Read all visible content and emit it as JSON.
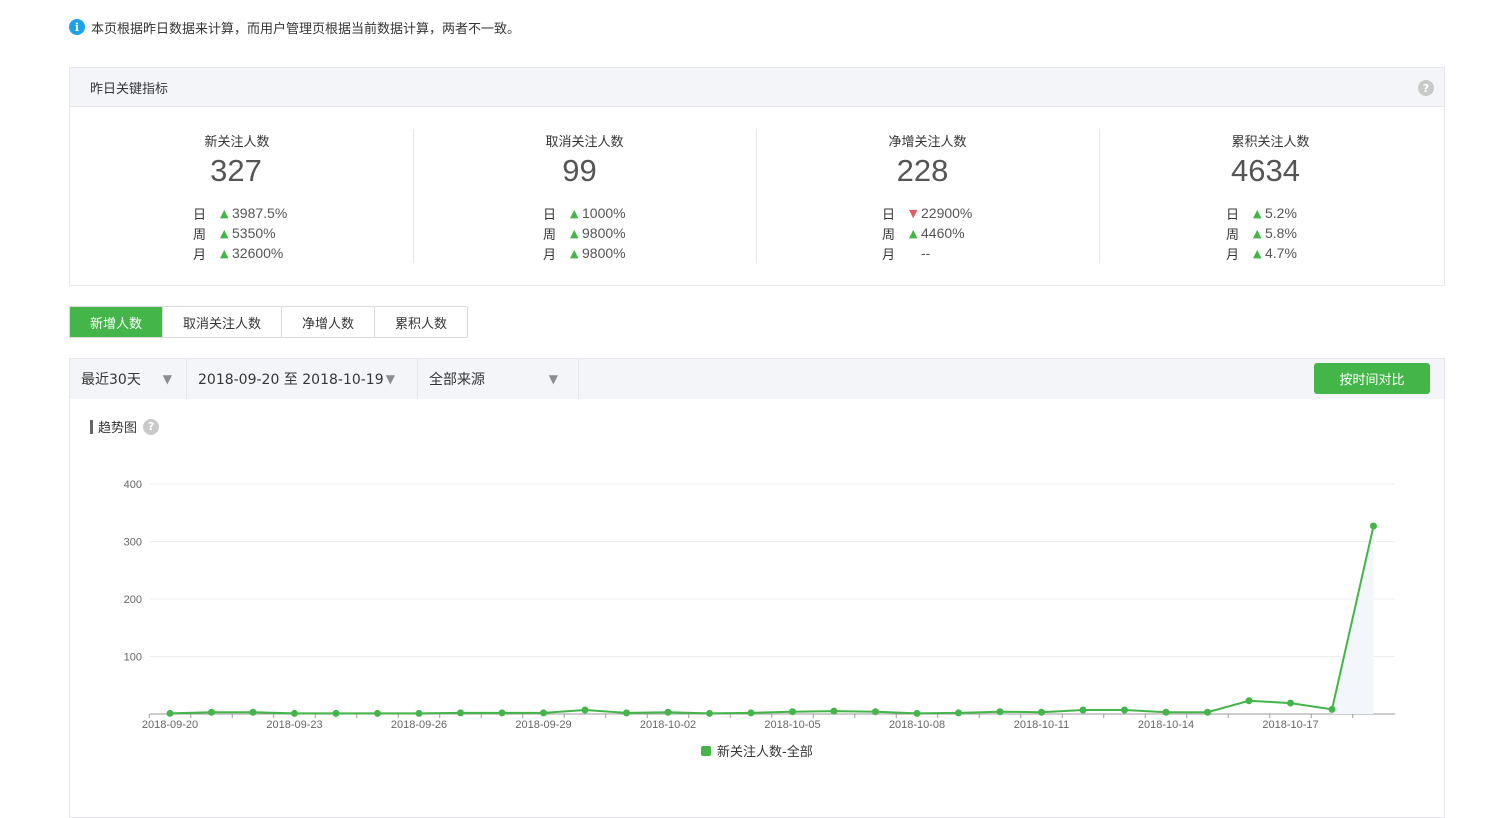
{
  "notice": {
    "icon": "info-icon",
    "text": "本页根据昨日数据来计算，而用户管理页根据当前数据计算，两者不一致。"
  },
  "kpi": {
    "title": "昨日关键指标",
    "help": "?",
    "period_labels": [
      "日",
      "周",
      "月"
    ],
    "cards": [
      {
        "title": "新关注人数",
        "value": "327",
        "rows": [
          {
            "dir": "up",
            "pct": "3987.5%"
          },
          {
            "dir": "up",
            "pct": "5350%"
          },
          {
            "dir": "up",
            "pct": "32600%"
          }
        ]
      },
      {
        "title": "取消关注人数",
        "value": "99",
        "rows": [
          {
            "dir": "up",
            "pct": "1000%"
          },
          {
            "dir": "up",
            "pct": "9800%"
          },
          {
            "dir": "up",
            "pct": "9800%"
          }
        ]
      },
      {
        "title": "净增关注人数",
        "value": "228",
        "rows": [
          {
            "dir": "down",
            "pct": "22900%"
          },
          {
            "dir": "up",
            "pct": "4460%"
          },
          {
            "dir": "none",
            "pct": "--"
          }
        ]
      },
      {
        "title": "累积关注人数",
        "value": "4634",
        "rows": [
          {
            "dir": "up",
            "pct": "5.2%"
          },
          {
            "dir": "up",
            "pct": "5.8%"
          },
          {
            "dir": "up",
            "pct": "4.7%"
          }
        ]
      }
    ]
  },
  "tabs": [
    "新增人数",
    "取消关注人数",
    "净增人数",
    "累积人数"
  ],
  "filters": {
    "range": "最近30天",
    "dates": "2018-09-20 至 2018-10-19",
    "source": "全部来源",
    "compare_button": "按时间对比"
  },
  "trend": {
    "title": "趋势图",
    "help": "?"
  },
  "colors": {
    "accent": "#44b549",
    "down": "#e15f63"
  },
  "chart_data": {
    "type": "line",
    "x": [
      "2018-09-20",
      "2018-09-21",
      "2018-09-22",
      "2018-09-23",
      "2018-09-24",
      "2018-09-25",
      "2018-09-26",
      "2018-09-27",
      "2018-09-28",
      "2018-09-29",
      "2018-09-30",
      "2018-10-01",
      "2018-10-02",
      "2018-10-03",
      "2018-10-04",
      "2018-10-05",
      "2018-10-06",
      "2018-10-07",
      "2018-10-08",
      "2018-10-09",
      "2018-10-10",
      "2018-10-11",
      "2018-10-12",
      "2018-10-13",
      "2018-10-14",
      "2018-10-15",
      "2018-10-16",
      "2018-10-17",
      "2018-10-18",
      "2018-10-19"
    ],
    "tick_labels": [
      "2018-09-20",
      "2018-09-23",
      "2018-09-26",
      "2018-09-29",
      "2018-10-02",
      "2018-10-05",
      "2018-10-08",
      "2018-10-11",
      "2018-10-14",
      "2018-10-17"
    ],
    "series": [
      {
        "name": "新关注人数-全部",
        "values": [
          1,
          3,
          3,
          1,
          1,
          1,
          1,
          2,
          2,
          2,
          7,
          2,
          3,
          1,
          2,
          4,
          5,
          4,
          1,
          2,
          4,
          3,
          7,
          7,
          3,
          3,
          23,
          19,
          8,
          327
        ]
      }
    ],
    "ylim": [
      0,
      400
    ],
    "yticks": [
      100,
      200,
      300,
      400
    ],
    "grid": true,
    "legend_position": "bottom"
  }
}
